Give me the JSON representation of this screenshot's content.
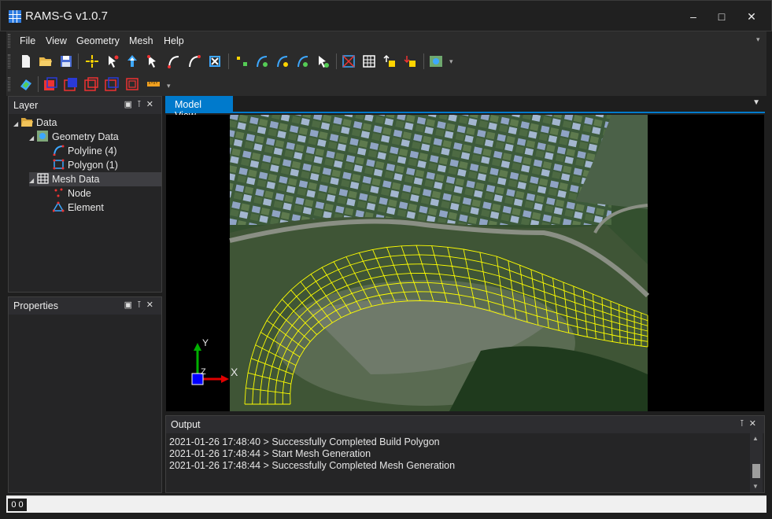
{
  "window": {
    "title": "RAMS-G v1.0.7",
    "minimize_icon": "minimize-icon",
    "maximize_icon": "maximize-icon",
    "close_icon": "close-icon"
  },
  "menu": [
    "File",
    "View",
    "Geometry",
    "Mesh",
    "Help"
  ],
  "toolbar1_icons": [
    "new-file-icon",
    "open-folder-icon",
    "save-icon",
    "add-point-icon",
    "move-point-icon",
    "select-point-icon",
    "edit-point-icon",
    "polyline-add-icon",
    "polyline-edit-icon",
    "polyline-delete-icon",
    "node-add-icon",
    "node-link-icon",
    "node-edit-icon",
    "node-move-icon",
    "node-delete-icon",
    "mesh-build-icon",
    "grid-icon",
    "mesh-export-icon",
    "mesh-import-icon",
    "background-map-icon"
  ],
  "toolbar2_icons": [
    "layer-icon",
    "cube-view-icon",
    "cube-front-icon",
    "cube-side-icon",
    "cube-top-icon",
    "cube-iso-icon",
    "ruler-icon"
  ],
  "layer_panel": {
    "title": "Layer",
    "tree": [
      {
        "label": "Data",
        "level": 0,
        "icon": "folder-open-icon"
      },
      {
        "label": "Geometry Data",
        "level": 1,
        "icon": "map-icon"
      },
      {
        "label": "Polyline (4)",
        "level": 2,
        "icon": "polyline-icon"
      },
      {
        "label": "Polygon (1)",
        "level": 2,
        "icon": "polygon-icon"
      },
      {
        "label": "Mesh Data",
        "level": 1,
        "icon": "mesh-icon",
        "selected": true
      },
      {
        "label": "Node",
        "level": 2,
        "icon": "node-icon"
      },
      {
        "label": "Element",
        "level": 2,
        "icon": "element-icon"
      }
    ]
  },
  "properties_panel": {
    "title": "Properties"
  },
  "model_view": {
    "tab_label": "Model View",
    "axis_y": "Y",
    "axis_z": "Z",
    "axis_x": "X",
    "mesh_color": "#ffff00"
  },
  "output_panel": {
    "title": "Output",
    "lines": [
      "2021-01-26 17:48:40 > Successfully Completed Build Polygon",
      "2021-01-26 17:48:44 > Start Mesh Generation",
      "2021-01-26 17:48:44 > Successfully Completed Mesh Generation"
    ]
  },
  "statusbar": {
    "coord": "0 0"
  },
  "colors": {
    "accent": "#007acc",
    "panel": "#252526",
    "background": "#1e1e1e"
  }
}
